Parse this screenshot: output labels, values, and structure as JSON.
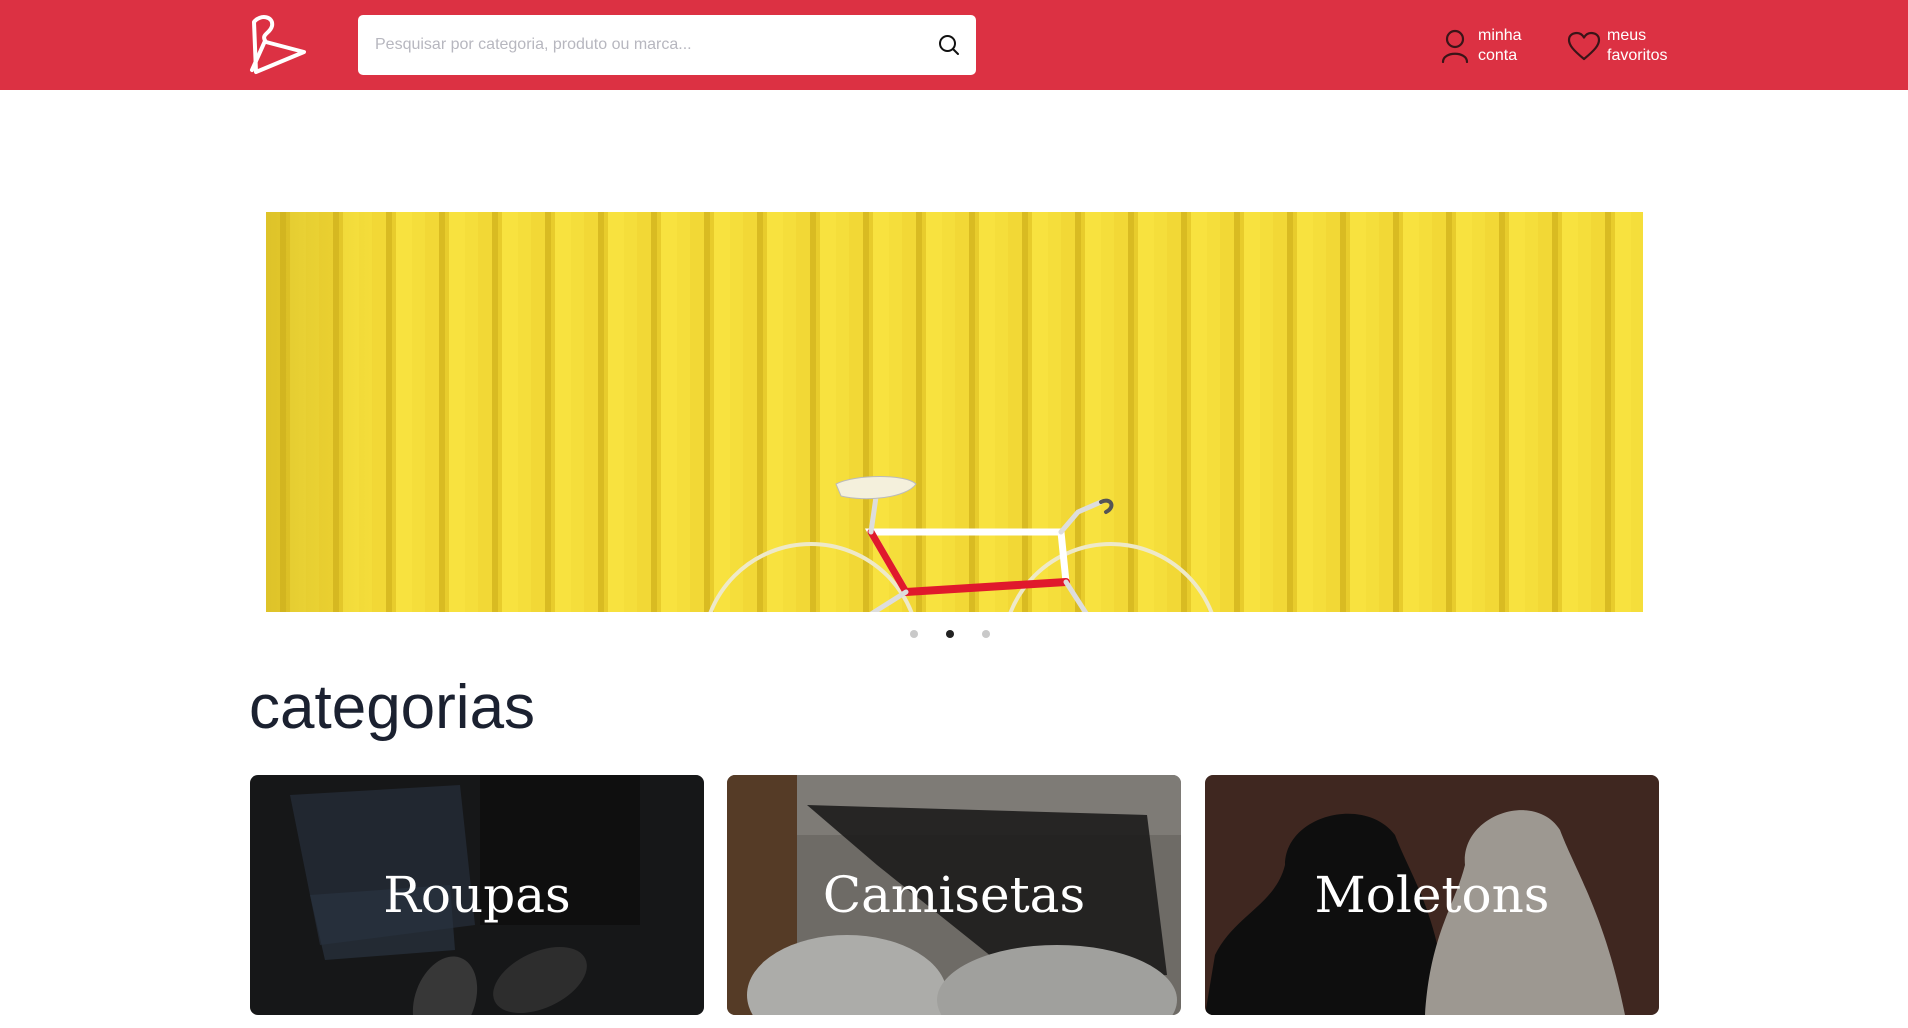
{
  "header": {
    "logo_icon": "hanger-icon",
    "background_color": "#dc3143",
    "search": {
      "placeholder": "Pesquisar por categoria, produto ou marca...",
      "value": "",
      "button_icon": "search-icon"
    },
    "account": {
      "icon": "user-icon",
      "line1": "minha",
      "line2": "conta"
    },
    "favorites": {
      "icon": "heart-icon",
      "line1": "meus",
      "line2": "favoritos"
    }
  },
  "banner": {
    "image": "yellow-wall-bicycle",
    "slides": 3,
    "active_slide": 2
  },
  "categories": {
    "title": "categorias",
    "items": [
      {
        "label": "Roupas",
        "image": "jeans-sneakers"
      },
      {
        "label": "Camisetas",
        "image": "shirts-rack"
      },
      {
        "label": "Moletons",
        "image": "hoodies"
      }
    ]
  }
}
